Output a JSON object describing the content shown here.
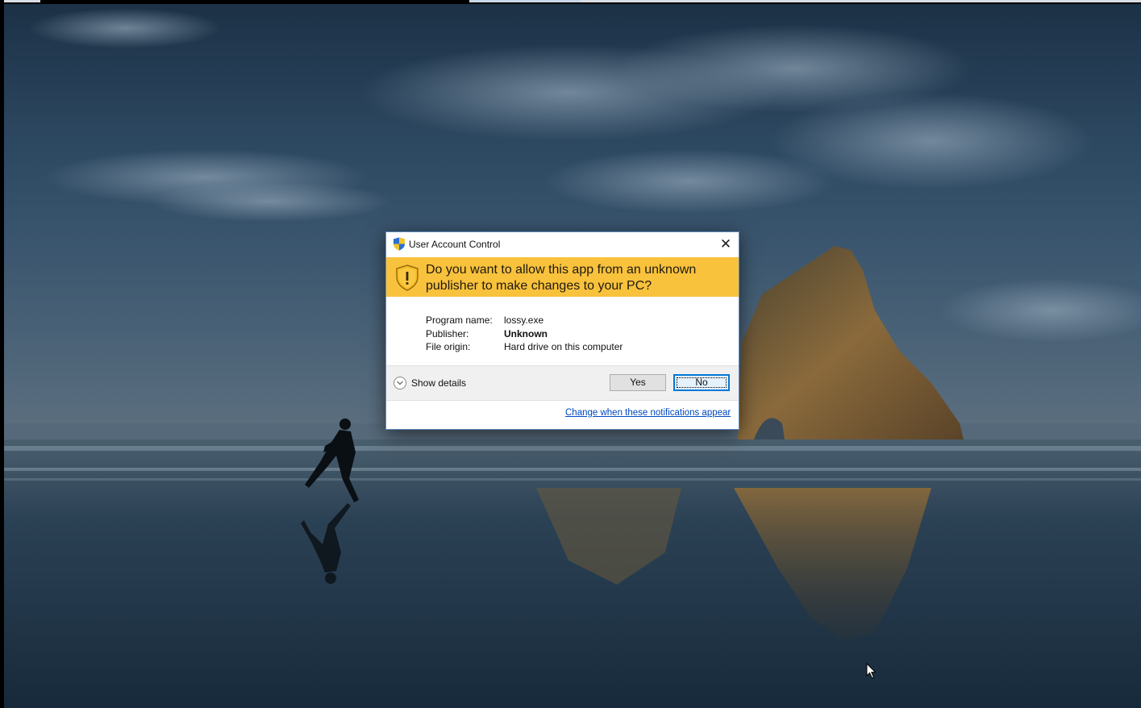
{
  "dialog": {
    "title": "User Account Control",
    "close_glyph": "✕",
    "question": "Do you want to allow this app from an unknown publisher to make changes to your PC?",
    "program_name_label": "Program name:",
    "program_name_value": "lossy.exe",
    "publisher_label": "Publisher:",
    "publisher_value": "Unknown",
    "file_origin_label": "File origin:",
    "file_origin_value": "Hard drive on this computer",
    "show_details_label": "Show details",
    "yes_label": "Yes",
    "no_label": "No",
    "change_link": "Change when these notifications appear"
  },
  "colors": {
    "banner": "#f9c23c",
    "link": "#0048c0",
    "focus_button_border": "#0078d7"
  },
  "icons": {
    "title": "uac-shield-icon",
    "banner": "warning-shield-icon",
    "details": "chevron-down-circle-icon",
    "close": "close-icon",
    "pointer": "mouse-cursor-icon"
  }
}
